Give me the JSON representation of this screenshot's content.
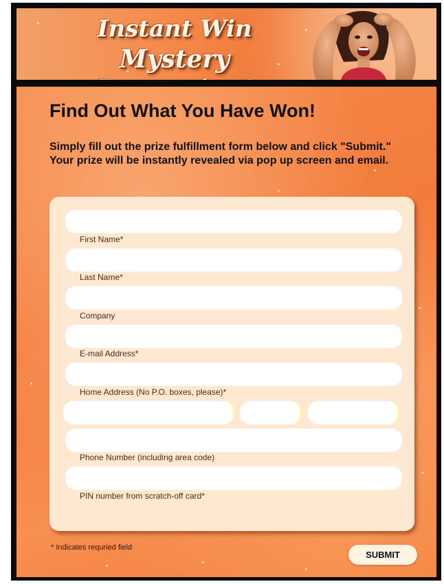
{
  "banner": {
    "title_line1": "Instant Win",
    "title_line2": "Mystery Promotion!"
  },
  "headline": "Find Out What You Have Won!",
  "intro": "Simply fill out the prize fulfillment form below and click \"Submit.\" Your prize will be instantly revealed via pop up screen and email.",
  "form": {
    "fields": {
      "first_name": {
        "label": "First Name*",
        "value": ""
      },
      "last_name": {
        "label": "Last Name*",
        "value": ""
      },
      "company": {
        "label": "Company",
        "value": ""
      },
      "email": {
        "label": "E-mail Address*",
        "value": ""
      },
      "home_address": {
        "label": "Home Address (No P.O. boxes, please)*",
        "value": ""
      },
      "city": {
        "value": ""
      },
      "state": {
        "value": ""
      },
      "zip": {
        "value": ""
      },
      "phone": {
        "label": "Phone Number (including area code)",
        "value": ""
      },
      "pin": {
        "label": "PIN number from scratch-off card*",
        "value": ""
      }
    },
    "required_note": "* Indicates requried field",
    "submit_label": "SUBMIT"
  },
  "colors": {
    "background_orange": "#f27c3c",
    "panel": "#ffe8d2",
    "field": "#ffffff",
    "field_accent": "#fff7a8",
    "text": "#111111"
  }
}
